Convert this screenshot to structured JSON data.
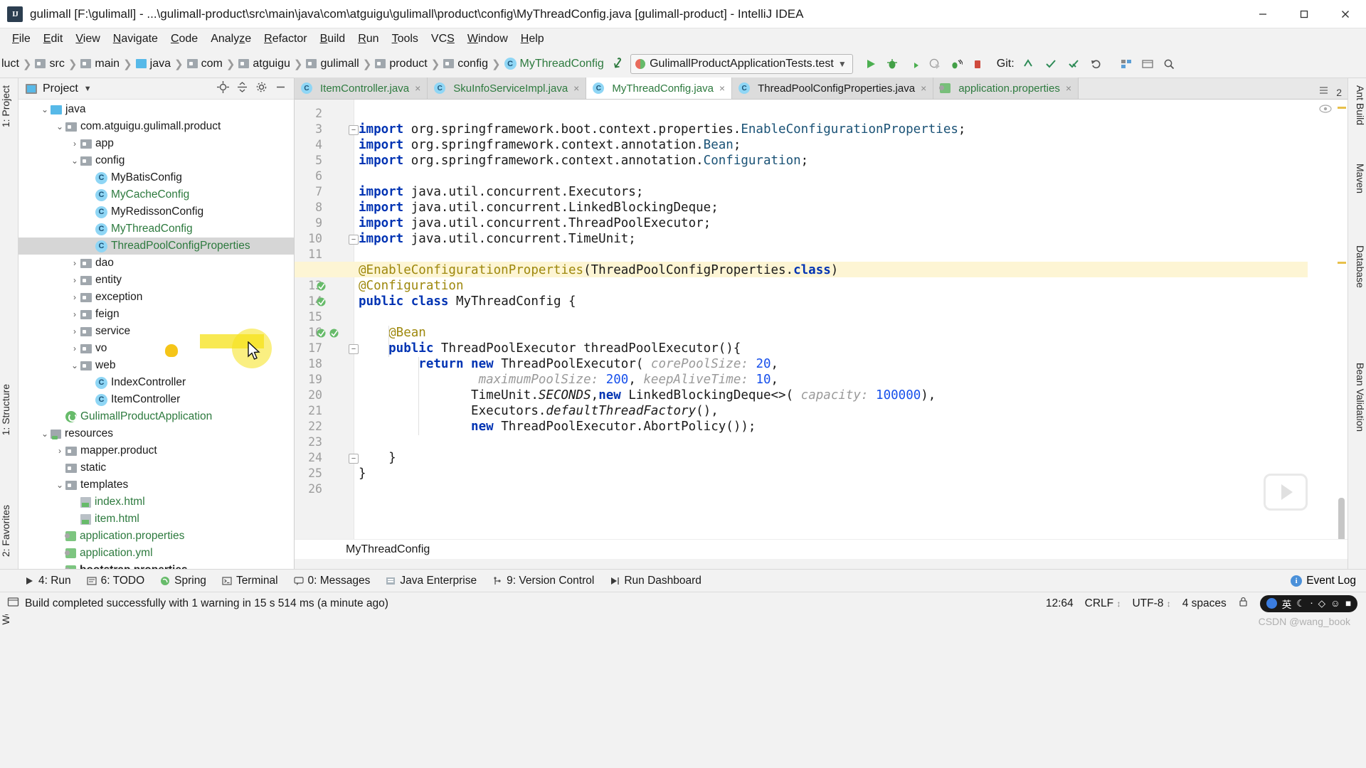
{
  "window": {
    "title": "gulimall [F:\\gulimall] - ...\\gulimall-product\\src\\main\\java\\com\\atguigu\\gulimall\\product\\config\\MyThreadConfig.java [gulimall-product] - IntelliJ IDEA",
    "logo_text": "IJ",
    "minimize": "minimize-icon",
    "maximize": "maximize-icon",
    "close": "close-icon"
  },
  "menubar": {
    "items": [
      {
        "label": "File",
        "mnemonic": "F"
      },
      {
        "label": "Edit",
        "mnemonic": "E"
      },
      {
        "label": "View",
        "mnemonic": "V"
      },
      {
        "label": "Navigate",
        "mnemonic": "N"
      },
      {
        "label": "Code",
        "mnemonic": "C"
      },
      {
        "label": "Analyze",
        "mnemonic": "z"
      },
      {
        "label": "Refactor",
        "mnemonic": "R"
      },
      {
        "label": "Build",
        "mnemonic": "B"
      },
      {
        "label": "Run",
        "mnemonic": "R"
      },
      {
        "label": "Tools",
        "mnemonic": "T"
      },
      {
        "label": "VCS",
        "mnemonic": "S"
      },
      {
        "label": "Window",
        "mnemonic": "W"
      },
      {
        "label": "Help",
        "mnemonic": "H"
      }
    ]
  },
  "toolbar": {
    "breadcrumbs": [
      {
        "label": "luct",
        "icon": "none",
        "type": "partial"
      },
      {
        "label": "src",
        "icon": "folder-icon",
        "type": "folder"
      },
      {
        "label": "main",
        "icon": "folder-icon",
        "type": "folder"
      },
      {
        "label": "java",
        "icon": "source-folder-icon",
        "type": "source"
      },
      {
        "label": "com",
        "icon": "package-icon",
        "type": "package"
      },
      {
        "label": "atguigu",
        "icon": "package-icon",
        "type": "package"
      },
      {
        "label": "gulimall",
        "icon": "package-icon",
        "type": "package"
      },
      {
        "label": "product",
        "icon": "package-icon",
        "type": "package"
      },
      {
        "label": "config",
        "icon": "package-icon",
        "type": "package"
      },
      {
        "label": "MyThreadConfig",
        "icon": "class-icon",
        "type": "class"
      }
    ],
    "back_icon": "navigate-back-icon",
    "run_configuration": "GulimallProductApplicationTests.test",
    "run_config_caret": "chevron-down-icon",
    "actions": [
      "run-icon",
      "debug-icon",
      "run-with-coverage-icon",
      "profile-icon",
      "attach-debugger-icon",
      "stop-icon"
    ],
    "git_label": "Git:",
    "git_actions": [
      "update-project-icon",
      "commit-icon",
      "push-icon",
      "rollback-icon"
    ],
    "right_actions": [
      "search-everywhere-icon",
      "settings-icon",
      "project-structure-icon"
    ]
  },
  "left_strip": {
    "items": [
      {
        "label": "1: Project",
        "name": "tool-window-project"
      },
      {
        "label": "1: Structure",
        "name": "tool-window-structure"
      },
      {
        "label": "2: Favorites",
        "name": "tool-window-favorites"
      },
      {
        "label": "Web",
        "name": "tool-window-web"
      }
    ]
  },
  "right_strip": {
    "items": [
      {
        "label": "Ant Build",
        "name": "tool-window-ant-build"
      },
      {
        "label": "Maven",
        "name": "tool-window-maven"
      },
      {
        "label": "Database",
        "name": "tool-window-database"
      },
      {
        "label": "Bean Validation",
        "name": "tool-window-bean-validation"
      }
    ]
  },
  "project_panel": {
    "title": "Project",
    "caret": "chevron-down-icon",
    "actions": [
      "locate-icon",
      "collapse-all-icon",
      "settings-icon",
      "hide-icon"
    ],
    "tree": [
      {
        "label": "java",
        "indent": 3,
        "arrow": "down",
        "icon": "source-folder-icon",
        "style": "plain",
        "selected": false
      },
      {
        "label": "com.atguigu.gulimall.product",
        "indent": 4,
        "arrow": "down",
        "icon": "package-icon",
        "style": "plain",
        "selected": false
      },
      {
        "label": "app",
        "indent": 5,
        "arrow": "right",
        "icon": "package-icon",
        "style": "plain",
        "selected": false
      },
      {
        "label": "config",
        "indent": 5,
        "arrow": "down",
        "icon": "package-icon",
        "style": "plain",
        "selected": false
      },
      {
        "label": "MyBatisConfig",
        "indent": 6,
        "arrow": "none",
        "icon": "class-icon",
        "style": "plain",
        "selected": false
      },
      {
        "label": "MyCacheConfig",
        "indent": 6,
        "arrow": "none",
        "icon": "class-icon",
        "style": "green",
        "selected": false
      },
      {
        "label": "MyRedissonConfig",
        "indent": 6,
        "arrow": "none",
        "icon": "class-icon",
        "style": "plain",
        "selected": false
      },
      {
        "label": "MyThreadConfig",
        "indent": 6,
        "arrow": "none",
        "icon": "class-icon",
        "style": "green",
        "selected": false
      },
      {
        "label": "ThreadPoolConfigProperties",
        "indent": 6,
        "arrow": "none",
        "icon": "class-icon",
        "style": "green",
        "selected": true
      },
      {
        "label": "dao",
        "indent": 5,
        "arrow": "right",
        "icon": "package-icon",
        "style": "plain",
        "selected": false
      },
      {
        "label": "entity",
        "indent": 5,
        "arrow": "right",
        "icon": "package-icon",
        "style": "plain",
        "selected": false
      },
      {
        "label": "exception",
        "indent": 5,
        "arrow": "right",
        "icon": "package-icon",
        "style": "plain",
        "selected": false
      },
      {
        "label": "feign",
        "indent": 5,
        "arrow": "right",
        "icon": "package-icon",
        "style": "plain",
        "selected": false
      },
      {
        "label": "service",
        "indent": 5,
        "arrow": "right",
        "icon": "package-icon",
        "style": "plain",
        "selected": false
      },
      {
        "label": "vo",
        "indent": 5,
        "arrow": "right",
        "icon": "package-icon",
        "style": "plain",
        "selected": false
      },
      {
        "label": "web",
        "indent": 5,
        "arrow": "down",
        "icon": "package-icon",
        "style": "plain",
        "selected": false
      },
      {
        "label": "IndexController",
        "indent": 6,
        "arrow": "none",
        "icon": "class-icon",
        "style": "plain",
        "selected": false
      },
      {
        "label": "ItemController",
        "indent": 6,
        "arrow": "none",
        "icon": "class-icon",
        "style": "plain",
        "selected": false
      },
      {
        "label": "GulimallProductApplication",
        "indent": 4,
        "arrow": "none",
        "icon": "spring-icon",
        "style": "green",
        "selected": false
      },
      {
        "label": "resources",
        "indent": 3,
        "arrow": "down",
        "icon": "resources-icon",
        "style": "plain",
        "selected": false
      },
      {
        "label": "mapper.product",
        "indent": 4,
        "arrow": "right",
        "icon": "package-icon",
        "style": "plain",
        "selected": false
      },
      {
        "label": "static",
        "indent": 4,
        "arrow": "none",
        "icon": "package-icon",
        "style": "plain",
        "selected": false
      },
      {
        "label": "templates",
        "indent": 4,
        "arrow": "down",
        "icon": "package-icon",
        "style": "plain",
        "selected": false
      },
      {
        "label": "index.html",
        "indent": 5,
        "arrow": "none",
        "icon": "html-icon",
        "style": "green",
        "selected": false
      },
      {
        "label": "item.html",
        "indent": 5,
        "arrow": "none",
        "icon": "html-icon",
        "style": "green",
        "selected": false
      },
      {
        "label": "application.properties",
        "indent": 4,
        "arrow": "none",
        "icon": "properties-icon",
        "style": "green",
        "selected": false
      },
      {
        "label": "application.yml",
        "indent": 4,
        "arrow": "none",
        "icon": "properties-icon",
        "style": "green",
        "selected": false
      },
      {
        "label": "bootstrap.properties",
        "indent": 4,
        "arrow": "none",
        "icon": "properties-icon",
        "style": "bold",
        "selected": false
      }
    ]
  },
  "tabs": [
    {
      "label": "ItemController.java",
      "icon": "class-icon",
      "style": "green",
      "active": false,
      "close": "close-icon"
    },
    {
      "label": "SkuInfoServiceImpl.java",
      "icon": "class-icon",
      "style": "green",
      "active": false,
      "close": "close-icon"
    },
    {
      "label": "MyThreadConfig.java",
      "icon": "class-icon",
      "style": "green",
      "active": true,
      "close": "close-icon"
    },
    {
      "label": "ThreadPoolConfigProperties.java",
      "icon": "class-icon",
      "style": "plain",
      "active": false,
      "close": "close-icon"
    },
    {
      "label": "application.properties",
      "icon": "properties-icon",
      "style": "green",
      "active": false,
      "close": "close-icon"
    }
  ],
  "tabbar_right": {
    "pin": "split-icon",
    "count": "2"
  },
  "editor": {
    "first_line": 2,
    "last_line": 26,
    "current_line": 12,
    "lines": [
      {
        "n": 2,
        "tokens": []
      },
      {
        "n": 3,
        "fold": "minus",
        "tokens": [
          {
            "t": "import ",
            "c": "kw"
          },
          {
            "t": "org.springframework.boot.context.properties.",
            "c": "typ"
          },
          {
            "t": "EnableConfigurationProperties",
            "c": "cls2"
          },
          {
            "t": ";",
            "c": "typ"
          }
        ]
      },
      {
        "n": 4,
        "tokens": [
          {
            "t": "import ",
            "c": "kw"
          },
          {
            "t": "org.springframework.context.annotation.",
            "c": "typ"
          },
          {
            "t": "Bean",
            "c": "cls2"
          },
          {
            "t": ";",
            "c": "typ"
          }
        ]
      },
      {
        "n": 5,
        "tokens": [
          {
            "t": "import ",
            "c": "kw"
          },
          {
            "t": "org.springframework.context.annotation.",
            "c": "typ"
          },
          {
            "t": "Configuration",
            "c": "cls2"
          },
          {
            "t": ";",
            "c": "typ"
          }
        ]
      },
      {
        "n": 6,
        "tokens": []
      },
      {
        "n": 7,
        "tokens": [
          {
            "t": "import ",
            "c": "kw"
          },
          {
            "t": "java.util.concurrent.Executors;",
            "c": "typ"
          }
        ]
      },
      {
        "n": 8,
        "tokens": [
          {
            "t": "import ",
            "c": "kw"
          },
          {
            "t": "java.util.concurrent.LinkedBlockingDeque;",
            "c": "typ"
          }
        ]
      },
      {
        "n": 9,
        "tokens": [
          {
            "t": "import ",
            "c": "kw"
          },
          {
            "t": "java.util.concurrent.ThreadPoolExecutor;",
            "c": "typ"
          }
        ]
      },
      {
        "n": 10,
        "fold": "minus",
        "tokens": [
          {
            "t": "import ",
            "c": "kw"
          },
          {
            "t": "java.util.concurrent.TimeUnit;",
            "c": "typ"
          }
        ]
      },
      {
        "n": 11,
        "tokens": []
      },
      {
        "n": 12,
        "fold": "minus",
        "tokens": [
          {
            "t": "@EnableConfigurationProperties",
            "c": "ann"
          },
          {
            "t": "(ThreadPoolConfigProperties.",
            "c": "typ"
          },
          {
            "t": "class",
            "c": "kw"
          },
          {
            "t": ")",
            "c": "typ"
          }
        ]
      },
      {
        "n": 13,
        "tokens": [
          {
            "t": "@Configuration",
            "c": "ann"
          }
        ]
      },
      {
        "n": 14,
        "tokens": [
          {
            "t": "public ",
            "c": "kw"
          },
          {
            "t": "class ",
            "c": "kw"
          },
          {
            "t": "MyThreadConfig {",
            "c": "typ"
          }
        ]
      },
      {
        "n": 15,
        "tokens": []
      },
      {
        "n": 16,
        "tokens": [
          {
            "t": "    @Bean",
            "c": "ann"
          }
        ]
      },
      {
        "n": 17,
        "fold": "minus",
        "tokens": [
          {
            "t": "    public ",
            "c": "kw"
          },
          {
            "t": "ThreadPoolExecutor threadPoolExecutor(){",
            "c": "typ"
          }
        ]
      },
      {
        "n": 18,
        "tokens": [
          {
            "t": "        return ",
            "c": "kw"
          },
          {
            "t": "new ",
            "c": "kw"
          },
          {
            "t": "ThreadPoolExecutor( ",
            "c": "typ"
          },
          {
            "t": "corePoolSize:",
            "c": "hint"
          },
          {
            "t": " ",
            "c": "typ"
          },
          {
            "t": "20",
            "c": "num"
          },
          {
            "t": ",",
            "c": "typ"
          }
        ]
      },
      {
        "n": 19,
        "tokens": [
          {
            "t": "                ",
            "c": "typ"
          },
          {
            "t": "maximumPoolSize:",
            "c": "hint"
          },
          {
            "t": " ",
            "c": "typ"
          },
          {
            "t": "200",
            "c": "num"
          },
          {
            "t": ", ",
            "c": "typ"
          },
          {
            "t": "keepAliveTime:",
            "c": "hint"
          },
          {
            "t": " ",
            "c": "typ"
          },
          {
            "t": "10",
            "c": "num"
          },
          {
            "t": ",",
            "c": "typ"
          }
        ]
      },
      {
        "n": 20,
        "tokens": [
          {
            "t": "               TimeUnit.",
            "c": "typ"
          },
          {
            "t": "SECONDS",
            "c": "ital"
          },
          {
            "t": ",",
            "c": "typ"
          },
          {
            "t": "new ",
            "c": "kw"
          },
          {
            "t": "LinkedBlockingDeque<>( ",
            "c": "typ"
          },
          {
            "t": "capacity:",
            "c": "hint"
          },
          {
            "t": " ",
            "c": "typ"
          },
          {
            "t": "100000",
            "c": "num"
          },
          {
            "t": "),",
            "c": "typ"
          }
        ]
      },
      {
        "n": 21,
        "tokens": [
          {
            "t": "               Executors.",
            "c": "typ"
          },
          {
            "t": "defaultThreadFactory",
            "c": "ital"
          },
          {
            "t": "(),",
            "c": "typ"
          }
        ]
      },
      {
        "n": 22,
        "tokens": [
          {
            "t": "               ",
            "c": "typ"
          },
          {
            "t": "new ",
            "c": "kw"
          },
          {
            "t": "ThreadPoolExecutor.AbortPolicy());",
            "c": "typ"
          }
        ]
      },
      {
        "n": 23,
        "tokens": []
      },
      {
        "n": 24,
        "fold": "minus",
        "tokens": [
          {
            "t": "    }",
            "c": "typ"
          }
        ]
      },
      {
        "n": 25,
        "tokens": [
          {
            "t": "}",
            "c": "typ"
          }
        ]
      },
      {
        "n": 26,
        "tokens": []
      }
    ],
    "breadcrumb": "MyThreadConfig",
    "eye_icon": "preview-eye-icon"
  },
  "bottom_bar": {
    "items": [
      {
        "label": "4: Run",
        "icon": "run-icon"
      },
      {
        "label": "6: TODO",
        "icon": "todo-icon"
      },
      {
        "label": "Spring",
        "icon": "spring-icon"
      },
      {
        "label": "Terminal",
        "icon": "terminal-icon"
      },
      {
        "label": "0: Messages",
        "icon": "messages-icon"
      },
      {
        "label": "Java Enterprise",
        "icon": "java-ee-icon"
      },
      {
        "label": "9: Version Control",
        "icon": "vcs-icon"
      },
      {
        "label": "Run Dashboard",
        "icon": "dashboard-icon"
      }
    ],
    "event_log": {
      "label": "Event Log",
      "icon": "info-icon"
    }
  },
  "status_bar": {
    "message": "Build completed successfully with 1 warning in 15 s 514 ms (a minute ago)",
    "message_icon": "build-icon",
    "caret_position": "12:64",
    "line_separator": "CRLF",
    "encoding": "UTF-8",
    "indent": "4 spaces",
    "ime": {
      "logo": "sogou-icon",
      "lang": "英",
      "tools": [
        "moon-icon",
        "keyboard-icon",
        "shapes-icon",
        "person-icon",
        "book-icon"
      ]
    }
  },
  "credit": "CSDN @wang_book"
}
